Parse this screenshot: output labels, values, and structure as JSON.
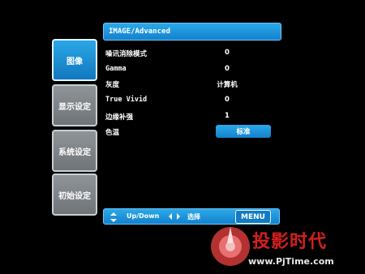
{
  "sidebar": {
    "tabs": [
      {
        "label": "图像",
        "active": true
      },
      {
        "label": "显示设定",
        "active": false
      },
      {
        "label": "系统设定",
        "active": false
      },
      {
        "label": "初始设定",
        "active": false
      }
    ]
  },
  "header": {
    "title": "IMAGE/Advanced"
  },
  "settings": [
    {
      "label": "噪讯消除模式",
      "value": "0"
    },
    {
      "label": "Gamma",
      "value": "0"
    },
    {
      "label": "灰度",
      "value": "计算机"
    },
    {
      "label": "True Vivid",
      "value": "0"
    },
    {
      "label": "边缘补强",
      "value": "1"
    },
    {
      "label": "色温",
      "value": "标准"
    }
  ],
  "footer": {
    "nav_hint": "Up/Down",
    "select_hint": "选择",
    "menu_label": "MENU"
  },
  "watermark": {
    "brand": "投影时代",
    "url": "www.PjTime.com"
  },
  "colors": {
    "accent": "#1a8fd8",
    "tab_inactive": "#7f8488",
    "watermark_red": "#d42020"
  }
}
